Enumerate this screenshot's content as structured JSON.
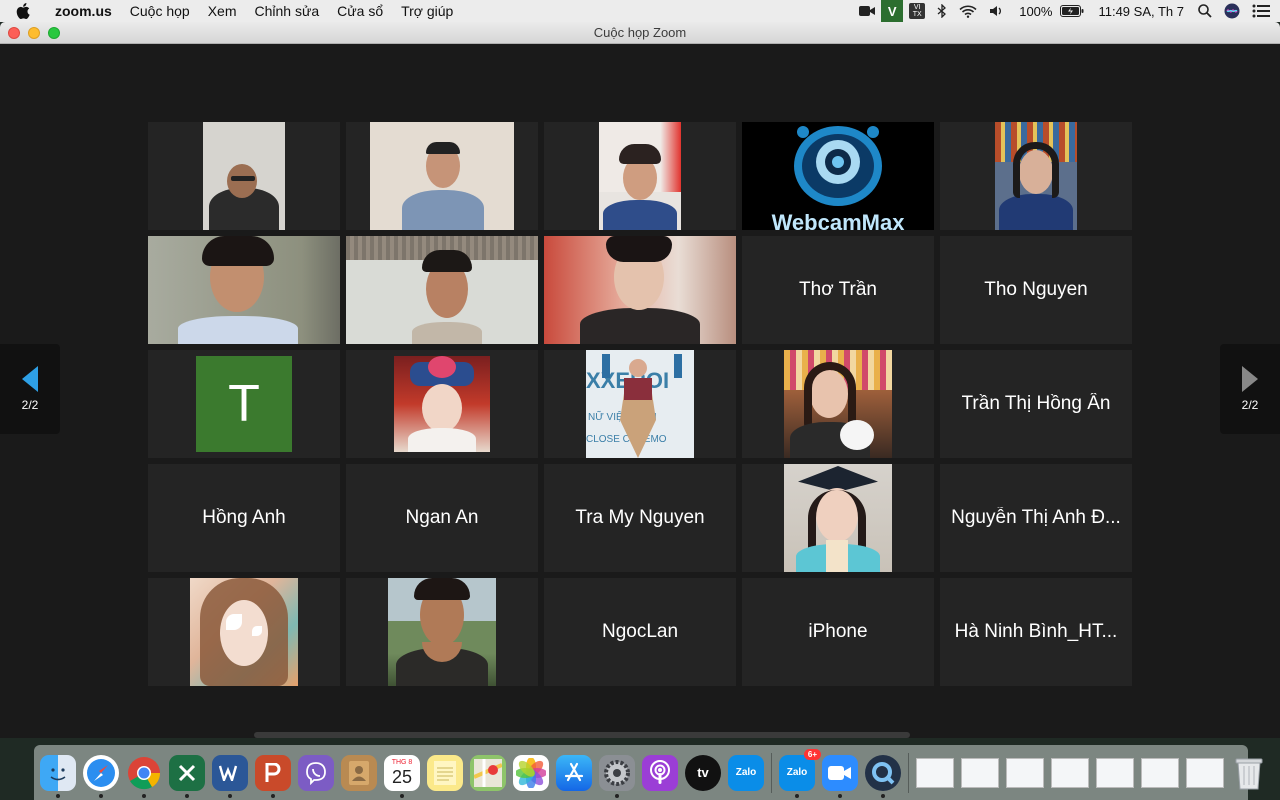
{
  "menubar": {
    "app_name": "zoom.us",
    "items": [
      "Cuộc họp",
      "Xem",
      "Chỉnh sửa",
      "Cửa sổ",
      "Trợ giúp"
    ],
    "status": {
      "v_label": "V",
      "vitx_top": "VI",
      "vitx_bottom": "TX",
      "battery": "100%",
      "clock": "11:49 SA, Th 7"
    }
  },
  "window": {
    "title": "Cuộc họp Zoom"
  },
  "pager": {
    "left_label": "2/2",
    "right_label": "2/2"
  },
  "tiles": {
    "r2c4_name": "Thơ Trần",
    "r2c5_name": "Tho Nguyen",
    "r3c1_letter": "T",
    "r3c5_name": "Trần Thị Hồng Ân",
    "r4c1_name": "Hồng Anh",
    "r4c2_name": "Ngan An",
    "r4c3_name": "Tra My Nguyen",
    "r4c5_name": "Nguyễn Thị Anh Đ...",
    "r5c3_name": "NgocLan",
    "r5c4_name": "iPhone",
    "r5c5_name": "Hà Ninh Bình_HT...",
    "webcam_text": "WebcamMax",
    "banner_text": "XXEROI",
    "banner_sub": "NỮ VIỆN BÌNH",
    "banner_sub2": "CLOSE CEREMO"
  },
  "dock": {
    "calendar_month": "THG 8",
    "calendar_day": "25",
    "zalo_label": "Zalo",
    "zalo_badge": "6+",
    "tv_label": "tv"
  }
}
